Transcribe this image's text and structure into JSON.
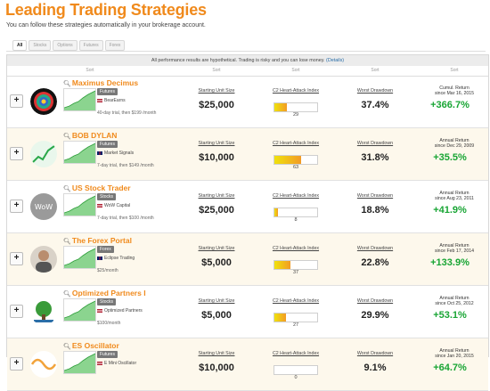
{
  "page": {
    "title": "Leading Trading Strategies",
    "subtitle": "You can follow these strategies automatically in your brokerage account."
  },
  "tabs": [
    "All",
    "Stocks",
    "Options",
    "Futures",
    "Forex"
  ],
  "notice": {
    "text": "All performance results are hypothetical. Trading is risky and you can lose money.",
    "details": "(Details)"
  },
  "sort_label": "Sort",
  "columns": {
    "unit": "Starting Unit Size",
    "heart": "C2 Heart-Attack Index",
    "drawdown": "Worst Drawdown"
  },
  "strategies": [
    {
      "name": "Maximus Decimus",
      "badge": "Futures",
      "flag": "us",
      "vendor": "BearEarns",
      "trial": "40-day trial, then $199 /month",
      "unit": "$25,000",
      "heart": 29,
      "drawdown": "37.4%",
      "ret_label": "Cumul. Return",
      "ret_since": "since Mar 16, 2015",
      "ret": "+366.7%",
      "logo": "swirl"
    },
    {
      "name": "BOB DYLAN",
      "badge": "Futures",
      "flag": "uk",
      "vendor": "Market Signals",
      "trial": "7-day trial, then $149 /month",
      "unit": "$10,000",
      "heart": 63,
      "drawdown": "31.8%",
      "ret_label": "Annual Return",
      "ret_since": "since Dec 29, 2009",
      "ret": "+35.5%",
      "logo": "chart"
    },
    {
      "name": "US Stock Trader",
      "badge": "Stocks",
      "flag": "us",
      "vendor": "WoW Capital",
      "trial": "7-day trial, then $100 /month",
      "unit": "$25,000",
      "heart": 8,
      "drawdown": "18.8%",
      "ret_label": "Annual Return",
      "ret_since": "since Aug 23, 2011",
      "ret": "+41.9%",
      "logo": "wow"
    },
    {
      "name": "The Forex Portal",
      "badge": "Forex",
      "flag": "uk",
      "vendor": "Eclipse Trading",
      "trial": "$25/month",
      "unit": "$5,000",
      "heart": 37,
      "drawdown": "22.8%",
      "ret_label": "Annual Return",
      "ret_since": "since Feb 17, 2014",
      "ret": "+133.9%",
      "logo": "person"
    },
    {
      "name": "Optimized Partners I",
      "badge": "Stocks",
      "flag": "us",
      "vendor": "Optimized Partners",
      "trial": "$100/month",
      "unit": "$5,000",
      "heart": 27,
      "drawdown": "29.9%",
      "ret_label": "Annual Return",
      "ret_since": "since Oct 25, 2012",
      "ret": "+53.1%",
      "logo": "tree"
    },
    {
      "name": "ES Oscillator",
      "badge": "Futures",
      "flag": "us",
      "vendor": "E Mini Oscillator",
      "trial": "",
      "unit": "$10,000",
      "heart": 0,
      "drawdown": "9.1%",
      "ret_label": "Annual Return",
      "ret_since": "since Jan 20, 2015",
      "ret": "+64.7%",
      "logo": "wave"
    }
  ]
}
